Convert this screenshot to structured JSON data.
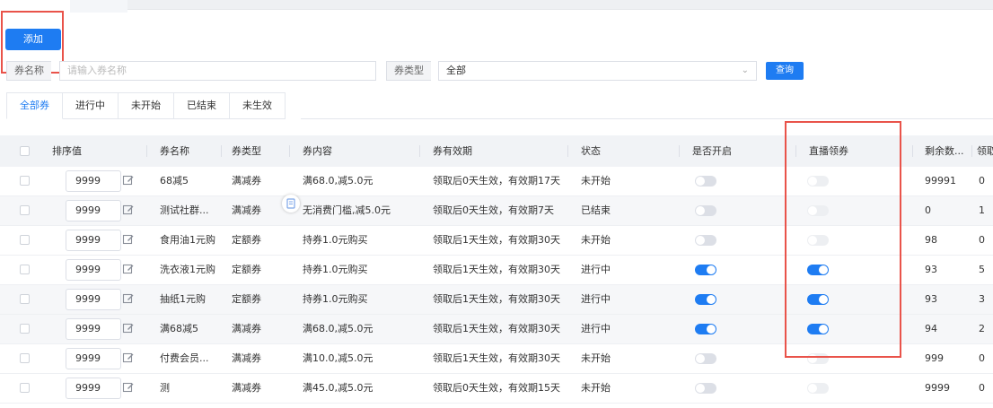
{
  "toolbar": {
    "add_label": "添加",
    "query_label": "查询"
  },
  "filters": {
    "name_label": "券名称",
    "name_placeholder": "请输入券名称",
    "type_label": "券类型",
    "type_value": "全部"
  },
  "tabs": [
    {
      "label": "全部券",
      "active": true
    },
    {
      "label": "进行中",
      "active": false
    },
    {
      "label": "未开始",
      "active": false
    },
    {
      "label": "已结束",
      "active": false
    },
    {
      "label": "未生效",
      "active": false
    }
  ],
  "table": {
    "headers": [
      "排序值",
      "券名称",
      "券类型",
      "券内容",
      "券有效期",
      "状态",
      "是否开启",
      "直播领券",
      "剩余数...",
      "领取"
    ],
    "rows": [
      {
        "sort": "9999",
        "name": "68减5",
        "type": "满减券",
        "content": "满68.0,减5.0元",
        "validity": "领取后0天生效，有效期17天",
        "status": "未开始",
        "enabled": "off",
        "live": "faint",
        "remaining": "99991",
        "claimed": "0"
      },
      {
        "sort": "9999",
        "name": "测试社群...",
        "type": "满减券",
        "content": "无消费门槛,减5.0元",
        "validity": "领取后0天生效，有效期7天",
        "status": "已结束",
        "enabled": "off",
        "live": "faint",
        "remaining": "0",
        "claimed": "1"
      },
      {
        "sort": "9999",
        "name": "食用油1元购",
        "type": "定额券",
        "content": "持券1.0元购买",
        "validity": "领取后1天生效，有效期30天",
        "status": "未开始",
        "enabled": "off",
        "live": "faint",
        "remaining": "98",
        "claimed": "0"
      },
      {
        "sort": "9999",
        "name": "洗衣液1元购",
        "type": "定额券",
        "content": "持券1.0元购买",
        "validity": "领取后1天生效，有效期30天",
        "status": "进行中",
        "enabled": "on",
        "live": "on",
        "remaining": "93",
        "claimed": "5"
      },
      {
        "sort": "9999",
        "name": "抽纸1元购",
        "type": "定额券",
        "content": "持券1.0元购买",
        "validity": "领取后1天生效，有效期30天",
        "status": "进行中",
        "enabled": "on",
        "live": "on",
        "remaining": "93",
        "claimed": "3"
      },
      {
        "sort": "9999",
        "name": "满68减5",
        "type": "满减券",
        "content": "满68.0,减5.0元",
        "validity": "领取后1天生效，有效期30天",
        "status": "进行中",
        "enabled": "on",
        "live": "on",
        "remaining": "94",
        "claimed": "2"
      },
      {
        "sort": "9999",
        "name": "付费会员...",
        "type": "满减券",
        "content": "满10.0,减5.0元",
        "validity": "领取后1天生效，有效期30天",
        "status": "未开始",
        "enabled": "off",
        "live": "faint",
        "remaining": "999",
        "claimed": "0"
      },
      {
        "sort": "9999",
        "name": "测",
        "type": "满减券",
        "content": "满45.0,减5.0元",
        "validity": "领取后0天生效，有效期15天",
        "status": "未开始",
        "enabled": "off",
        "live": "faint",
        "remaining": "9999",
        "claimed": "0"
      }
    ]
  },
  "colors": {
    "primary": "#1e7cf2",
    "highlight": "#e9534a"
  },
  "icons": {
    "edit": "edit-icon",
    "chevron": "chevron-down-icon",
    "float": "document-icon"
  }
}
